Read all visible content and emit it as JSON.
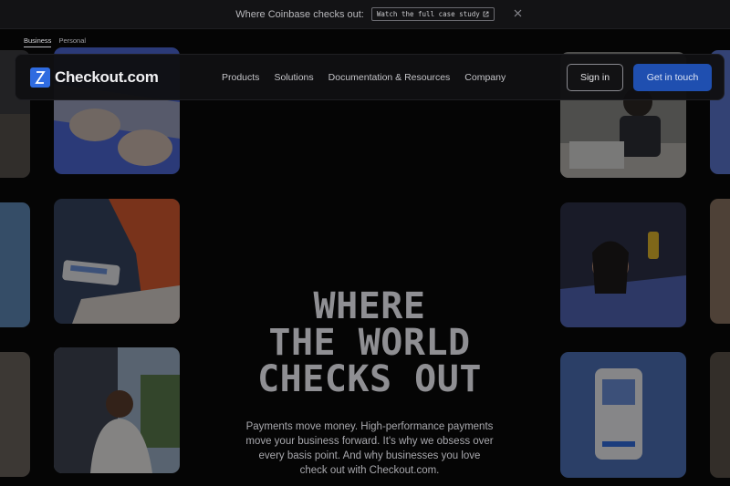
{
  "banner": {
    "text": "Where Coinbase checks out:",
    "link_label": "Watch the full case study",
    "close_icon": "close-icon",
    "external_icon": "external-link-icon"
  },
  "audience": {
    "business": "Business",
    "personal": "Personal",
    "selected": "Business"
  },
  "nav": {
    "brand": "Checkout.com",
    "links": [
      "Products",
      "Solutions",
      "Documentation & Resources",
      "Company"
    ],
    "sign_in": "Sign in",
    "cta": "Get in touch"
  },
  "hero": {
    "title_lines": [
      "WHERE",
      "THE WORLD",
      "CHECKS OUT"
    ],
    "body": "Payments move money. High-performance payments move your business forward. It's why we obsess over every basis point. And why businesses you love check out with Checkout.com."
  },
  "colors": {
    "accent": "#1f4fb0",
    "logo": "#2f6be0",
    "background": "#050505"
  }
}
